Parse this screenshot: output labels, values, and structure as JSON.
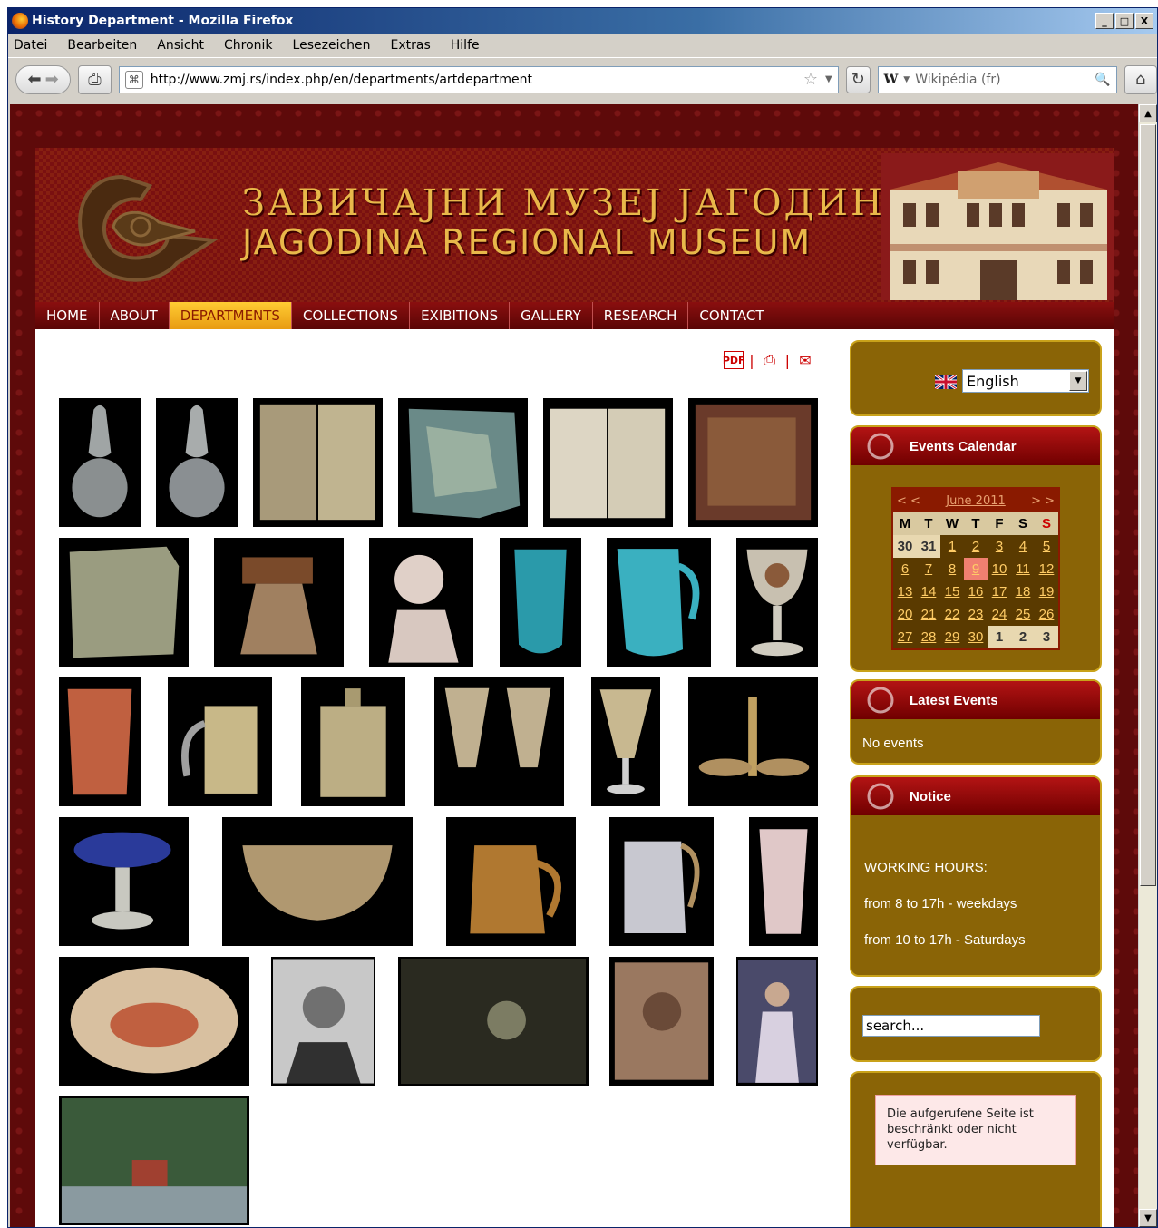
{
  "window": {
    "title": "History Department - Mozilla Firefox",
    "controls": [
      "_",
      "□",
      "X"
    ]
  },
  "menu": [
    "Datei",
    "Bearbeiten",
    "Ansicht",
    "Chronik",
    "Lesezeichen",
    "Extras",
    "Hilfe"
  ],
  "toolbar": {
    "url": "http://www.zmj.rs/index.php/en/departments/artdepartment",
    "search_placeholder": "Wikipédia (fr)",
    "search_engine_icon": "W"
  },
  "site": {
    "title_cyrillic": "ЗАВИЧАЈНИ МУЗЕЈ ЈАГОДИНА",
    "title_latin": "JAGODINA REGIONAL MUSEUM",
    "nav": [
      "HOME",
      "ABOUT",
      "DEPARTMENTS",
      "COLLECTIONS",
      "EXIBITIONS",
      "GALLERY",
      "RESEARCH",
      "CONTACT"
    ],
    "active_nav": "DEPARTMENTS"
  },
  "sidebar": {
    "language": "English",
    "events_calendar": {
      "title": "Events Calendar",
      "month_label": "June 2011",
      "prev": "< <",
      "next": "> >",
      "weekdays": [
        "M",
        "T",
        "W",
        "T",
        "F",
        "S",
        "S"
      ],
      "weeks": [
        [
          "30",
          "31",
          "1",
          "2",
          "3",
          "4",
          "5"
        ],
        [
          "6",
          "7",
          "8",
          "9",
          "10",
          "11",
          "12"
        ],
        [
          "13",
          "14",
          "15",
          "16",
          "17",
          "18",
          "19"
        ],
        [
          "20",
          "21",
          "22",
          "23",
          "24",
          "25",
          "26"
        ],
        [
          "27",
          "28",
          "29",
          "30",
          "1",
          "2",
          "3"
        ]
      ],
      "today": "9"
    },
    "latest_events": {
      "title": "Latest Events",
      "text": "No events"
    },
    "notice": {
      "title": "Notice",
      "heading": "WORKING HOURS:",
      "line1": "from 8 to 17h - weekdays",
      "line2": "from 10 to 17h - Saturdays"
    },
    "search": {
      "placeholder": "search..."
    },
    "restricted_message": "Die aufgerufene Seite ist beschränkt oder nicht verfügbar."
  },
  "colors": {
    "header_red": "#7a1010",
    "nav_active": "#ffcc33",
    "module_gold": "#8a6406",
    "module_head": "#b31414"
  }
}
